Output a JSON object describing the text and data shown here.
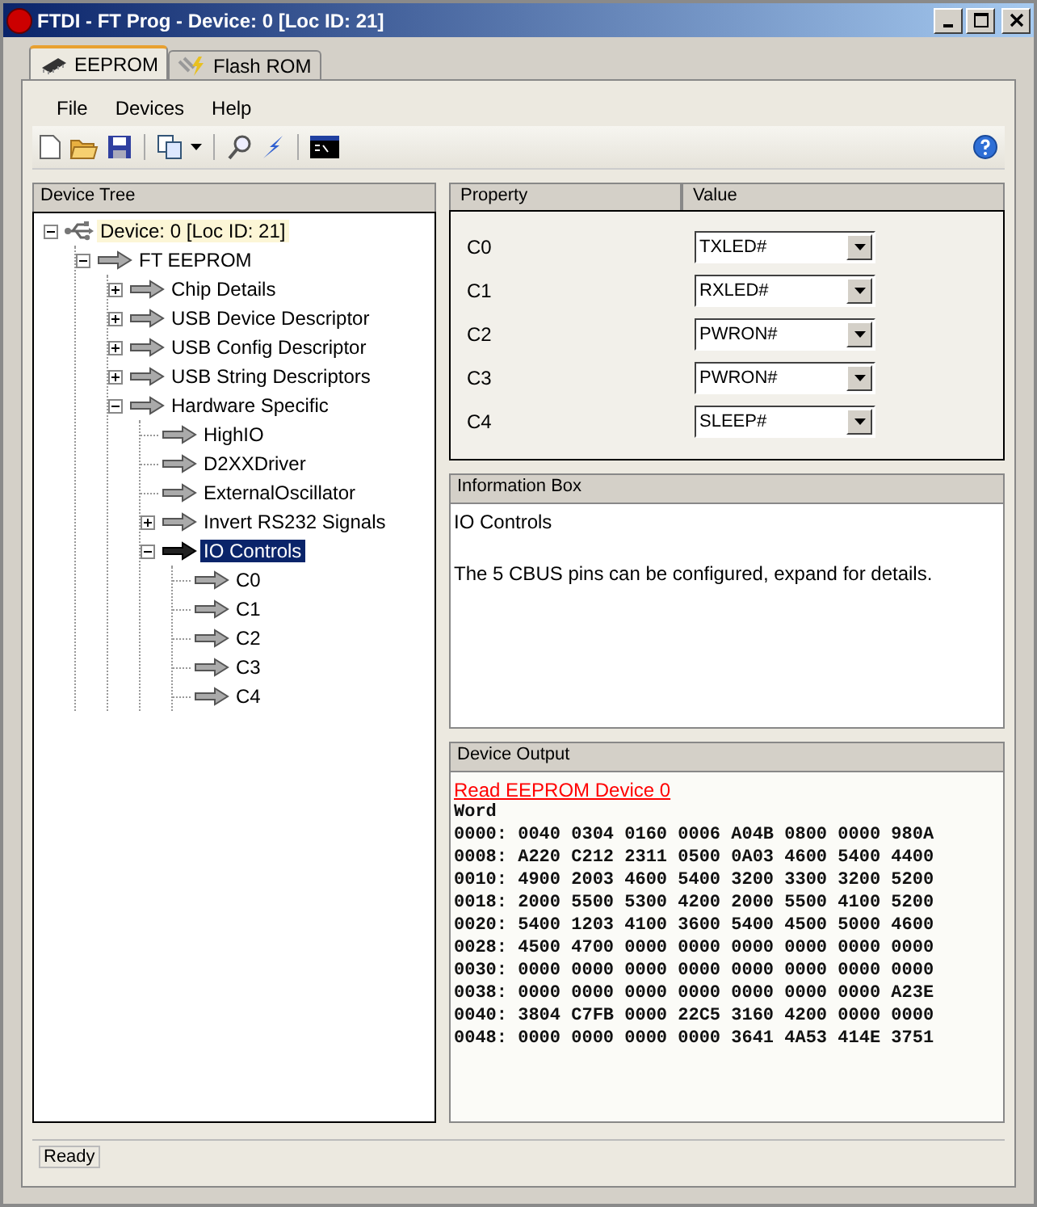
{
  "window": {
    "title": "FTDI - FT Prog - Device: 0 [Loc ID: 21]"
  },
  "tabs": [
    {
      "label": "EEPROM",
      "selected": true,
      "kind": "chip"
    },
    {
      "label": "Flash ROM",
      "selected": false,
      "kind": "flash"
    }
  ],
  "menu": [
    "File",
    "Devices",
    "Help"
  ],
  "device_tree": {
    "title": "Device Tree",
    "items": [
      {
        "label": "Device: 0 [Loc ID: 21]",
        "kind": "device",
        "expanded": true,
        "selected": false,
        "children": [
          {
            "label": "FT EEPROM",
            "kind": "node",
            "expanded": true,
            "selected": false,
            "children": [
              {
                "label": "Chip Details",
                "kind": "node",
                "expanded": false,
                "selected": false
              },
              {
                "label": "USB Device Descriptor",
                "kind": "node",
                "expanded": false,
                "selected": false
              },
              {
                "label": "USB Config Descriptor",
                "kind": "node",
                "expanded": false,
                "selected": false
              },
              {
                "label": "USB String Descriptors",
                "kind": "node",
                "expanded": false,
                "selected": false
              },
              {
                "label": "Hardware Specific",
                "kind": "node",
                "expanded": true,
                "selected": false,
                "children": [
                  {
                    "label": "HighIO",
                    "kind": "node",
                    "selected": false
                  },
                  {
                    "label": "D2XXDriver",
                    "kind": "node",
                    "selected": false
                  },
                  {
                    "label": "ExternalOscillator",
                    "kind": "node",
                    "selected": false
                  },
                  {
                    "label": "Invert RS232 Signals",
                    "kind": "node",
                    "expanded": false,
                    "selected": false
                  },
                  {
                    "label": "IO Controls",
                    "kind": "node",
                    "expanded": true,
                    "selected": true,
                    "children": [
                      {
                        "label": "C0",
                        "kind": "node",
                        "selected": false
                      },
                      {
                        "label": "C1",
                        "kind": "node",
                        "selected": false
                      },
                      {
                        "label": "C2",
                        "kind": "node",
                        "selected": false
                      },
                      {
                        "label": "C3",
                        "kind": "node",
                        "selected": false
                      },
                      {
                        "label": "C4",
                        "kind": "node",
                        "selected": false
                      }
                    ]
                  }
                ]
              }
            ]
          }
        ]
      }
    ]
  },
  "properties": {
    "columns": [
      "Property",
      "Value"
    ],
    "rows": [
      {
        "name": "C0",
        "value": "TXLED#"
      },
      {
        "name": "C1",
        "value": "RXLED#"
      },
      {
        "name": "C2",
        "value": "PWRON#"
      },
      {
        "name": "C3",
        "value": "PWRON#"
      },
      {
        "name": "C4",
        "value": "SLEEP#"
      }
    ]
  },
  "information_box": {
    "title": "Information Box",
    "heading": "IO Controls",
    "text": "The 5 CBUS pins can be configured, expand for details."
  },
  "device_output": {
    "title": "Device Output",
    "link": "Read EEPROM Device 0",
    "lines": [
      "Word",
      "0000: 0040 0304 0160 0006 A04B 0800 0000 980A",
      "0008: A220 C212 2311 0500 0A03 4600 5400 4400",
      "0010: 4900 2003 4600 5400 3200 3300 3200 5200",
      "0018: 2000 5500 5300 4200 2000 5500 4100 5200",
      "0020: 5400 1203 4100 3600 5400 4500 5000 4600",
      "0028: 4500 4700 0000 0000 0000 0000 0000 0000",
      "0030: 0000 0000 0000 0000 0000 0000 0000 0000",
      "0038: 0000 0000 0000 0000 0000 0000 0000 A23E",
      "0040: 3804 C7FB 0000 22C5 3160 4200 0000 0000",
      "0048: 0000 0000 0000 0000 3641 4A53 414E 3751"
    ]
  },
  "status_bar": "Ready"
}
